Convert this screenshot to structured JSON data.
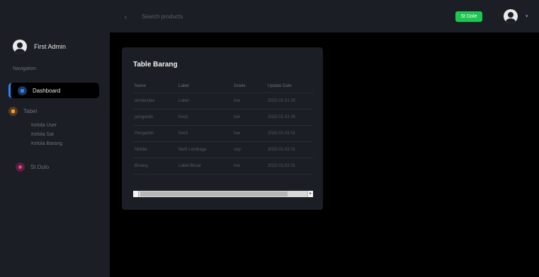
{
  "topbar": {
    "search_placeholder": "Search products",
    "green_button": "St Dole"
  },
  "sidebar": {
    "brand_name": "First Admin",
    "nav_heading": "Navigation",
    "items": [
      {
        "label": "Dashboard"
      },
      {
        "label": "Tabel"
      },
      {
        "label": "St Dulo"
      }
    ],
    "sub_items": [
      "Kelola User",
      "Kelola Sat",
      "Kelola Barang"
    ]
  },
  "card": {
    "title": "Table Barang",
    "columns": [
      "Name",
      "Label",
      "Grade",
      "Update Date"
    ],
    "rows": [
      [
        "amidesitas",
        "Label",
        "low",
        "2022-01-01 00"
      ],
      [
        "pengantin",
        "Kecil",
        "low",
        "2022-01-01 00"
      ],
      [
        "Pengantin",
        "Kecil",
        "low",
        "2022-01-03 01"
      ],
      [
        "Mobile",
        "Multi Lembaga",
        "sop",
        "2022-01-03 01"
      ],
      [
        "Binang",
        "Label Besar",
        "low",
        "2022-01-03 01"
      ]
    ]
  },
  "colors": {
    "sidebar_bg": "#1b1e24",
    "accent_blue": "#2a86ff",
    "button_green": "#1cc651",
    "main_bg": "#000000"
  }
}
